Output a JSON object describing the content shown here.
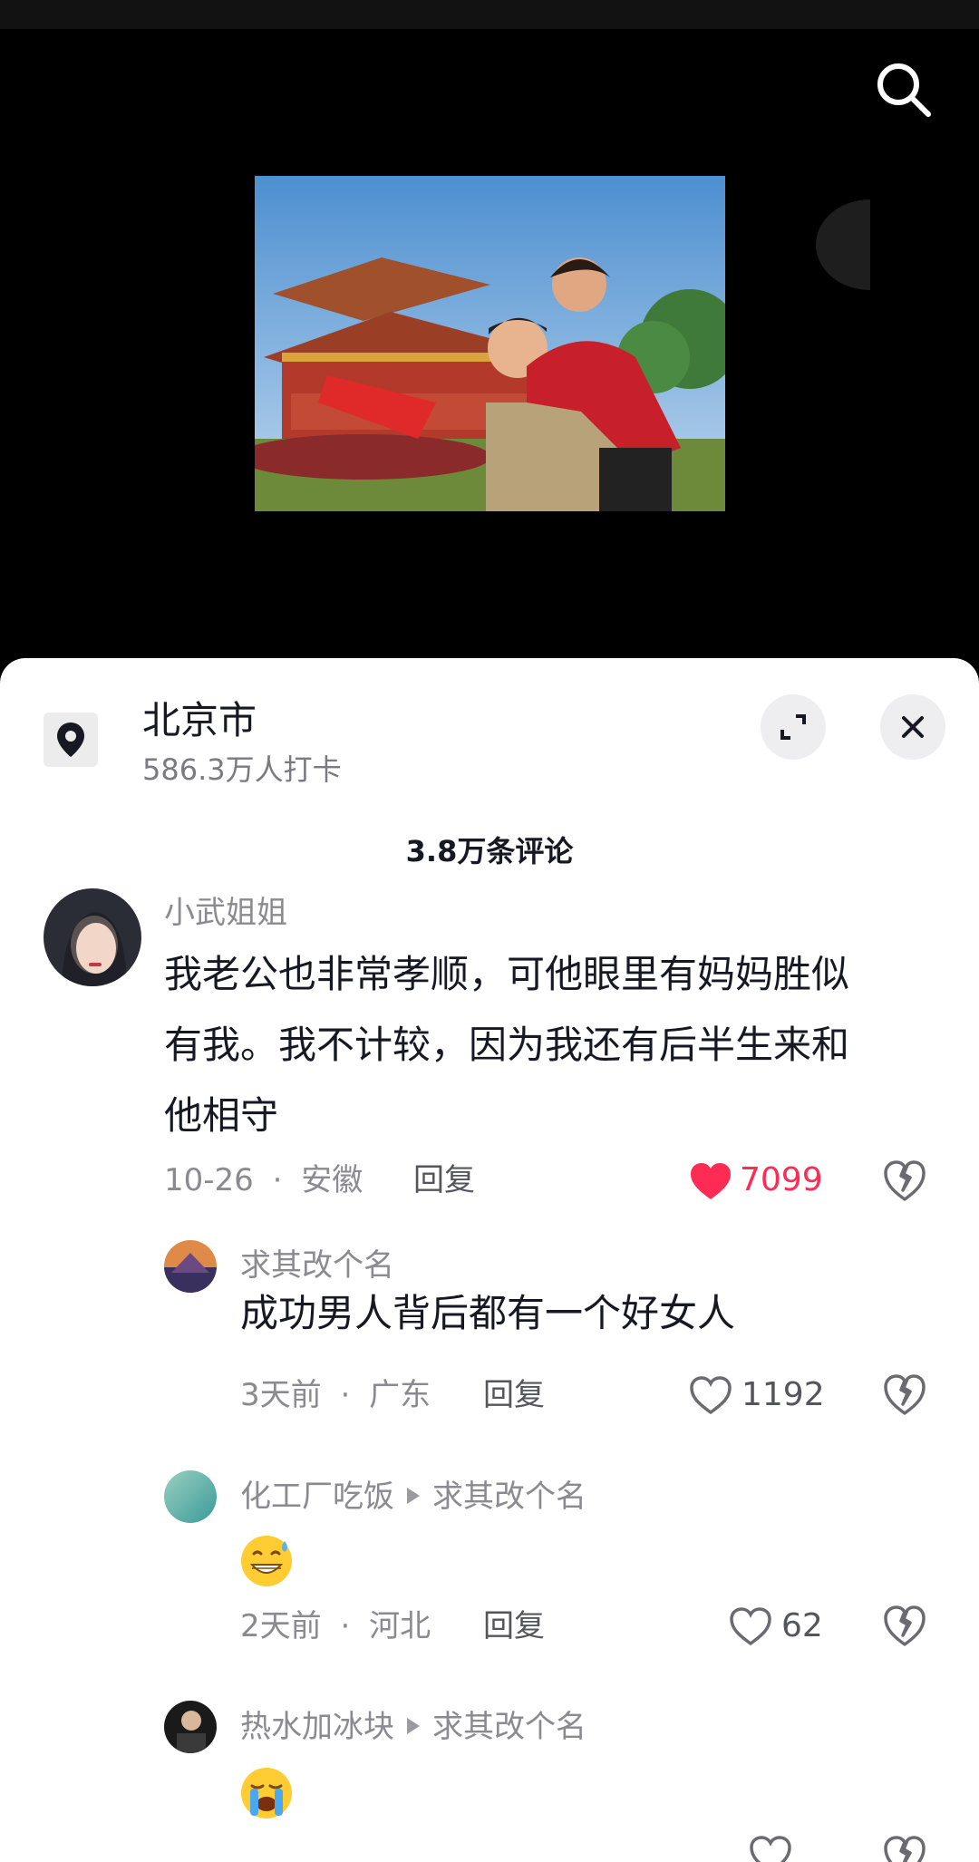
{
  "header": {
    "search_icon": "search-icon"
  },
  "location": {
    "name": "北京市",
    "checkins": "586.3万人打卡",
    "icon": "location-pin-icon"
  },
  "comments_header": {
    "count_label": "3.8万条评论"
  },
  "comments": [
    {
      "username": "小武姐姐",
      "text": "我老公也非常孝顺，可他眼里有妈妈胜似有我。我不计较，因为我还有后半生来和他相守",
      "lines": [
        "我老公也非常孝顺，可他眼里有妈妈胜似",
        "有我。我不计较，因为我还有后半生来和",
        "他相守"
      ],
      "date": "10-26",
      "region": "安徽",
      "reply_label": "回复",
      "likes": "7099",
      "liked": true,
      "replies": [
        {
          "username": "求其改个名",
          "text": "成功男人背后都有一个好女人",
          "date": "3天前",
          "region": "广东",
          "reply_label": "回复",
          "likes": "1192",
          "liked": false
        },
        {
          "username": "化工厂吃饭",
          "reply_to": "求其改个名",
          "emoji": "grinning-sweat-emoji",
          "date": "2天前",
          "region": "河北",
          "reply_label": "回复",
          "likes": "62",
          "liked": false
        },
        {
          "username": "热水加冰块",
          "reply_to": "求其改个名",
          "emoji": "loudly-crying-emoji"
        }
      ]
    }
  ],
  "meta_separator": "·",
  "colors": {
    "accent_like": "#fe2c55",
    "sheet_bg": "#ffffff",
    "video_bg": "#000000"
  }
}
